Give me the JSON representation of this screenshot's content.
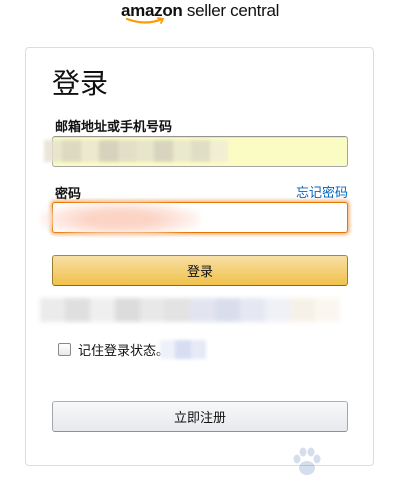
{
  "header": {
    "logo_brand": "amazon",
    "logo_suffix": " seller central"
  },
  "signin": {
    "title": "登录",
    "email_label": "邮箱地址或手机号码",
    "email_value": "",
    "password_label": "密码",
    "forgot_link": "忘记密码",
    "password_value": "",
    "submit_label": "登录",
    "remember_label": "记住登录状态。",
    "remember_checked": false,
    "register_label": "立即注册"
  },
  "colors": {
    "accent_button": "#f0c14b",
    "link": "#0066c0",
    "focus_border": "#e77600",
    "autofill_bg": "#fbfcc3"
  }
}
